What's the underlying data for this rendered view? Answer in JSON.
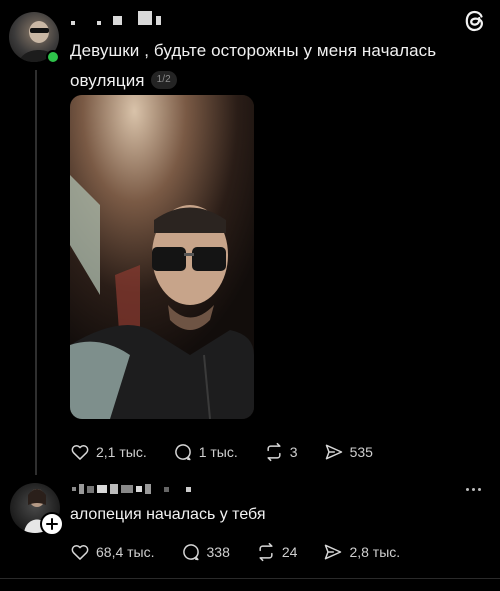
{
  "post": {
    "text": "Девушки , будьте осторожны у меня началась овуляция",
    "pager": "1/2",
    "stats": {
      "likes": "2,1 тыс.",
      "comments": "1 тыс.",
      "reposts": "3",
      "shares": "535"
    }
  },
  "reply": {
    "text": "алопеция началась у тебя",
    "stats": {
      "likes": "68,4 тыс.",
      "comments": "338",
      "reposts": "24",
      "shares": "2,8 тыс."
    }
  },
  "icons": {
    "app_logo": "threads-logo-icon",
    "like": "heart-icon",
    "comment": "comment-bubble-icon",
    "repost": "repost-icon",
    "share": "send-icon",
    "more": "more-dots-icon",
    "follow": "plus-icon"
  },
  "colors": {
    "background": "#000000",
    "text": "#f1f1f1",
    "muted": "#cfcfcf",
    "online_dot": "#2ec24a"
  }
}
